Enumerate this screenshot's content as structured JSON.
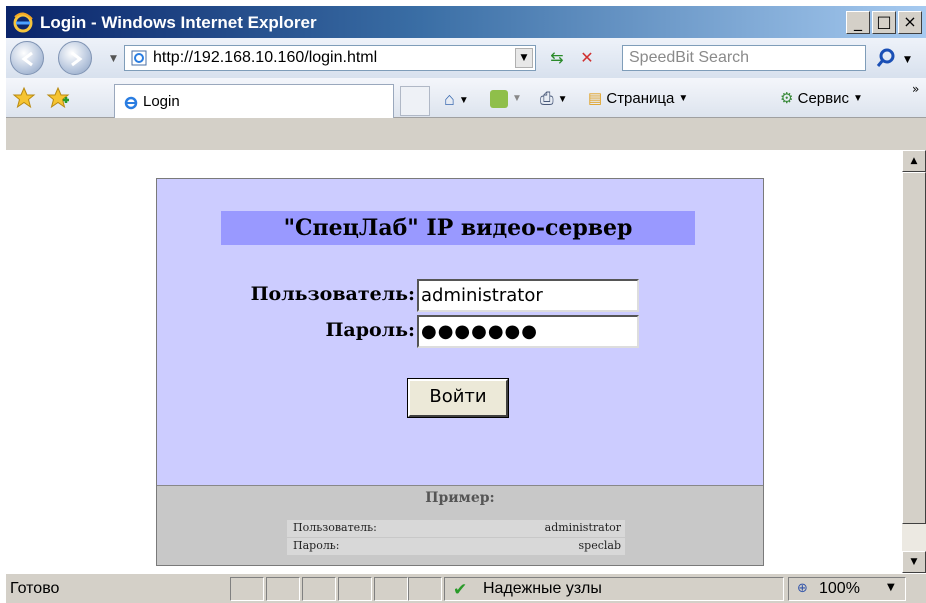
{
  "window": {
    "title": "Login - Windows Internet Explorer",
    "buttons": {
      "minimize": "_",
      "maximize": "□",
      "close": "×"
    }
  },
  "address_bar": {
    "url": "http://192.168.10.160/login.html",
    "search_placeholder": "SpeedBit Search"
  },
  "tabs": [
    {
      "label": "Login"
    }
  ],
  "commands": {
    "page": "Страница",
    "tools": "Сервис"
  },
  "login_form": {
    "heading": "\"СпецЛаб\" IP видео-сервер",
    "username_label": "Пользователь:",
    "username_value": "administrator",
    "password_label": "Пароль:",
    "password_value": "●●●●●●●",
    "submit_label": "Войти"
  },
  "example": {
    "heading": "Пример:",
    "rows": [
      {
        "key": "Пользователь:",
        "value": "administrator"
      },
      {
        "key": "Пароль:",
        "value": "speclab"
      }
    ]
  },
  "status_bar": {
    "status": "Готово",
    "zone": "Надежные узлы",
    "zoom": "100%"
  },
  "colors": {
    "panel": "#ccccff",
    "banner": "#9999ff",
    "example_bg": "#c8c8c8"
  }
}
